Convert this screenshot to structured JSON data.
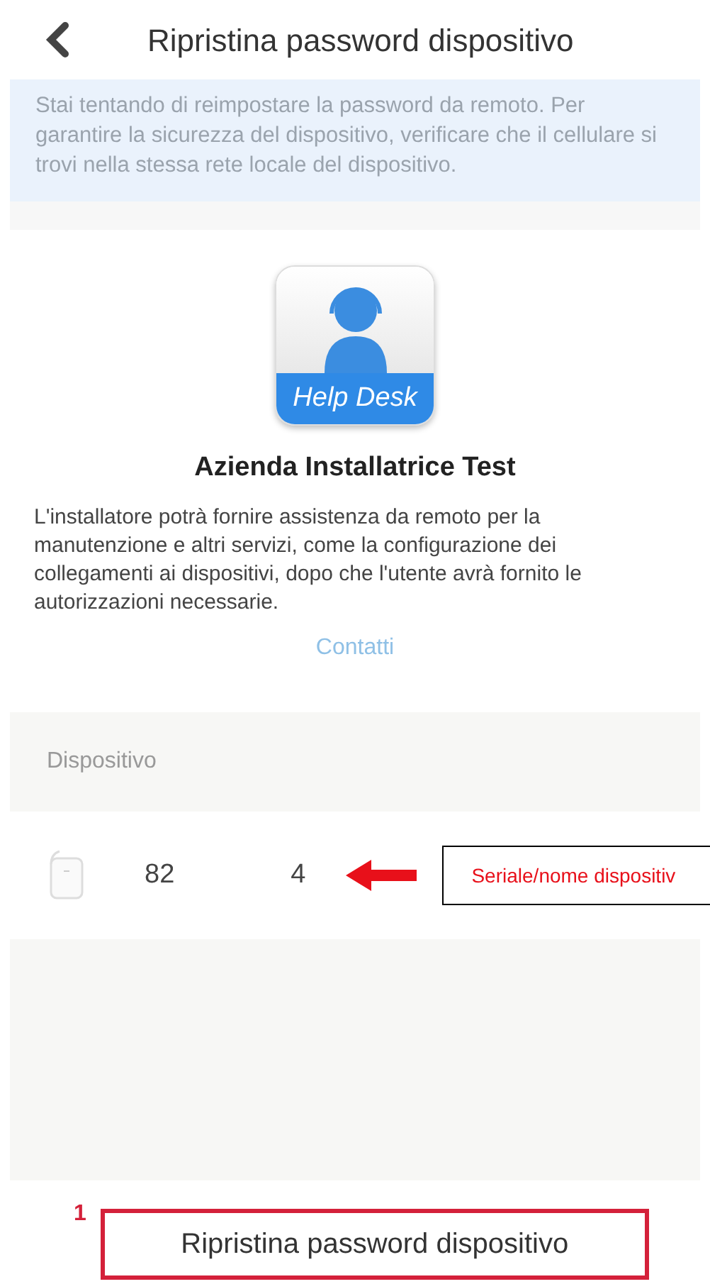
{
  "header": {
    "title": "Ripristina password dispositivo"
  },
  "notice": "Stai tentando di reimpostare la password da remoto. Per garantire la sicurezza del dispositivo, verificare che il cellulare si trovi nella stessa rete locale del dispositivo.",
  "installer": {
    "logo_caption": "Help Desk",
    "name": "Azienda Installatrice Test",
    "description": "L'installatore potrà fornire assistenza da remoto per la manutenzione e altri servizi, come la configurazione dei collegamenti ai dispositivi, dopo che l'utente avrà fornito le autorizzazioni necessarie.",
    "contact_link": "Contatti"
  },
  "device_section": {
    "label": "Dispositivo",
    "device": {
      "serial_start": "82",
      "serial_end": "4"
    },
    "annotation": "Seriale/nome dispositiv"
  },
  "action": {
    "marker": "1",
    "button": "Ripristina password dispositivo"
  }
}
